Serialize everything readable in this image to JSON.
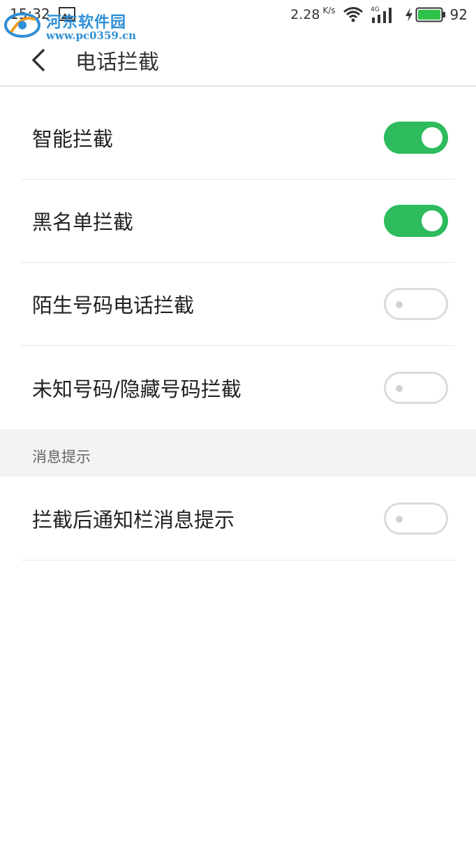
{
  "statusbar": {
    "time": "15:32",
    "speed": "2.28",
    "speed_unit": "K/s",
    "network": "4G",
    "battery": "92"
  },
  "watermark": {
    "name": "河东软件园",
    "url": "www.pc0359.cn"
  },
  "header": {
    "title": "电话拦截"
  },
  "settings": [
    {
      "label": "智能拦截",
      "enabled": true
    },
    {
      "label": "黑名单拦截",
      "enabled": true
    },
    {
      "label": "陌生号码电话拦截",
      "enabled": false
    },
    {
      "label": "未知号码/隐藏号码拦截",
      "enabled": false
    }
  ],
  "section": {
    "title": "消息提示"
  },
  "notify_settings": [
    {
      "label": "拦截后通知栏消息提示",
      "enabled": false
    }
  ],
  "colors": {
    "toggle_on": "#2dbb5d",
    "toggle_off_border": "#dcdcdc",
    "battery": "#2fc24a"
  }
}
